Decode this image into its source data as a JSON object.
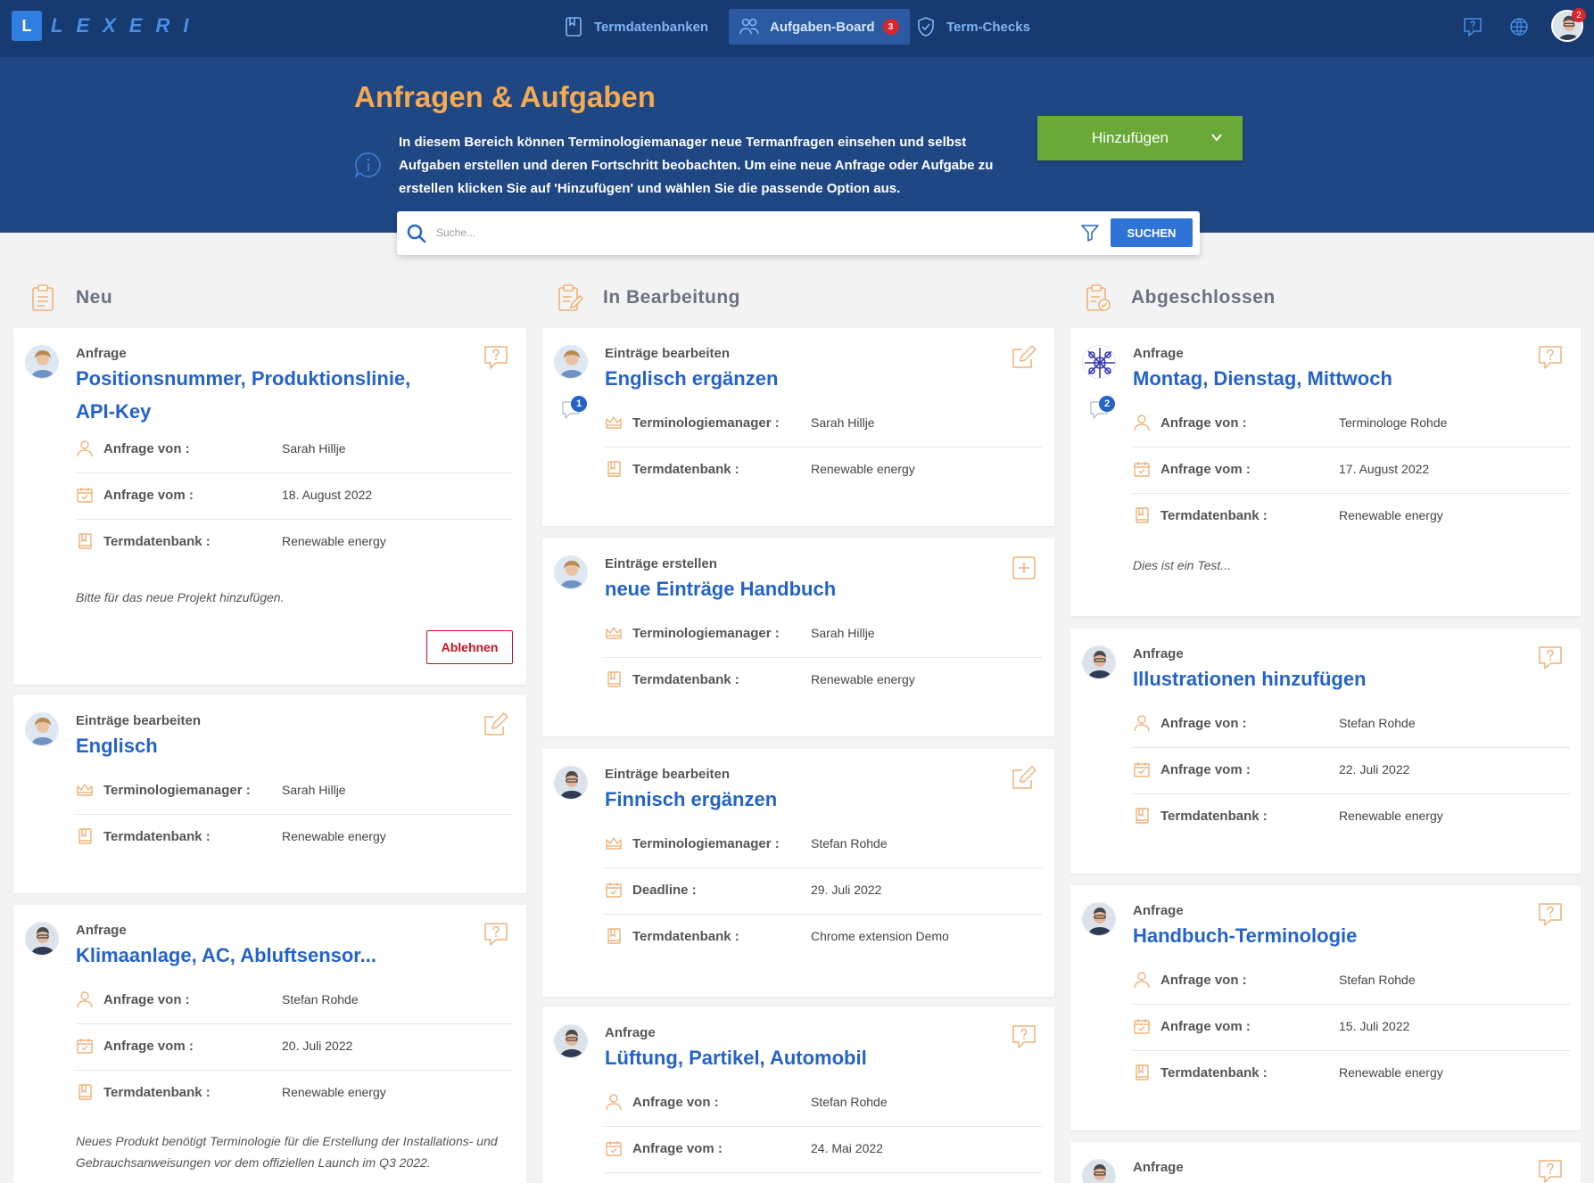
{
  "nav": {
    "logo": "L",
    "brand": "LEXERI",
    "items": [
      {
        "label": "Termdatenbanken"
      },
      {
        "label": "Aufgaben-Board",
        "badge": "3"
      },
      {
        "label": "Term-Checks"
      }
    ],
    "avatar_badge": "2"
  },
  "hero": {
    "title": "Anfragen & Aufgaben",
    "description": "In diesem Bereich können Terminologiemanager neue Termanfragen einsehen und selbst Aufgaben erstellen und deren Fortschritt beobachten. Um eine neue Anfrage oder Aufgabe zu erstellen klicken Sie auf 'Hinzufügen' und wählen Sie die passende Option aus.",
    "add_label": "Hinzufügen",
    "search_placeholder": "Suche...",
    "search_button": "SUCHEN"
  },
  "columns": [
    {
      "title": "Neu"
    },
    {
      "title": "In Bearbeitung"
    },
    {
      "title": "Abgeschlossen"
    }
  ],
  "neu": [
    {
      "type": "Anfrage",
      "title": "Positionsnummer, Produktionslinie, API-Key",
      "rows": [
        {
          "label": "Anfrage von :",
          "value": "Sarah Hillje"
        },
        {
          "label": "Anfrage vom :",
          "value": "18. August 2022"
        },
        {
          "label": "Termdatenbank :",
          "value": "Renewable energy"
        }
      ],
      "note": "Bitte für das neue Projekt hinzufügen.",
      "reject": "Ablehnen"
    },
    {
      "type": "Einträge bearbeiten",
      "title": "Englisch",
      "rows": [
        {
          "label": "Terminologiemanager :",
          "value": "Sarah Hillje"
        },
        {
          "label": "Termdatenbank :",
          "value": "Renewable energy"
        }
      ]
    },
    {
      "type": "Anfrage",
      "title": "Klimaanlage, AC, Abluftsensor...",
      "rows": [
        {
          "label": "Anfrage von :",
          "value": "Stefan Rohde"
        },
        {
          "label": "Anfrage vom :",
          "value": "20. Juli 2022"
        },
        {
          "label": "Termdatenbank :",
          "value": "Renewable energy"
        }
      ],
      "note": "Neues Produkt benötigt Terminologie für die Erstellung der Installations- und Gebrauchsanweisungen vor dem offiziellen Launch im Q3 2022."
    }
  ],
  "bearbeitung": [
    {
      "type": "Einträge bearbeiten",
      "title": "Englisch ergänzen",
      "comments": "1",
      "rows": [
        {
          "label": "Terminologiemanager :",
          "value": "Sarah Hillje"
        },
        {
          "label": "Termdatenbank :",
          "value": "Renewable energy"
        }
      ]
    },
    {
      "type": "Einträge erstellen",
      "title": "neue Einträge Handbuch",
      "rows": [
        {
          "label": "Terminologiemanager :",
          "value": "Sarah Hillje"
        },
        {
          "label": "Termdatenbank :",
          "value": "Renewable energy"
        }
      ]
    },
    {
      "type": "Einträge bearbeiten",
      "title": "Finnisch ergänzen",
      "rows": [
        {
          "label": "Terminologiemanager :",
          "value": "Stefan Rohde"
        },
        {
          "label": "Deadline :",
          "value": "29. Juli 2022"
        },
        {
          "label": "Termdatenbank :",
          "value": "Chrome extension Demo"
        }
      ]
    },
    {
      "type": "Anfrage",
      "title": "Lüftung, Partikel, Automobil",
      "rows": [
        {
          "label": "Anfrage von :",
          "value": "Stefan Rohde"
        },
        {
          "label": "Anfrage vom :",
          "value": "24. Mai 2022"
        }
      ]
    }
  ],
  "abgeschlossen": [
    {
      "type": "Anfrage",
      "title": "Montag, Dienstag, Mittwoch",
      "comments": "2",
      "rows": [
        {
          "label": "Anfrage von :",
          "value": "Terminologe Rohde"
        },
        {
          "label": "Anfrage vom :",
          "value": "17. August 2022"
        },
        {
          "label": "Termdatenbank :",
          "value": "Renewable energy"
        }
      ],
      "note": "Dies ist ein Test..."
    },
    {
      "type": "Anfrage",
      "title": "Illustrationen hinzufügen",
      "rows": [
        {
          "label": "Anfrage von :",
          "value": "Stefan Rohde"
        },
        {
          "label": "Anfrage vom :",
          "value": "22. Juli 2022"
        },
        {
          "label": "Termdatenbank :",
          "value": "Renewable energy"
        }
      ]
    },
    {
      "type": "Anfrage",
      "title": "Handbuch-Terminologie",
      "rows": [
        {
          "label": "Anfrage von :",
          "value": "Stefan Rohde"
        },
        {
          "label": "Anfrage vom :",
          "value": "15. Juli 2022"
        },
        {
          "label": "Termdatenbank :",
          "value": "Renewable energy"
        }
      ]
    },
    {
      "type": "Anfrage"
    }
  ],
  "colors": {
    "nav_bg": "#173a70",
    "hero_bg": "#1f4784",
    "accent_orange": "#f5a950",
    "title_blue": "#2563c9",
    "add_green": "#6aa938",
    "reject_red": "#c8101e",
    "icon_orange": "#f0b27a"
  }
}
